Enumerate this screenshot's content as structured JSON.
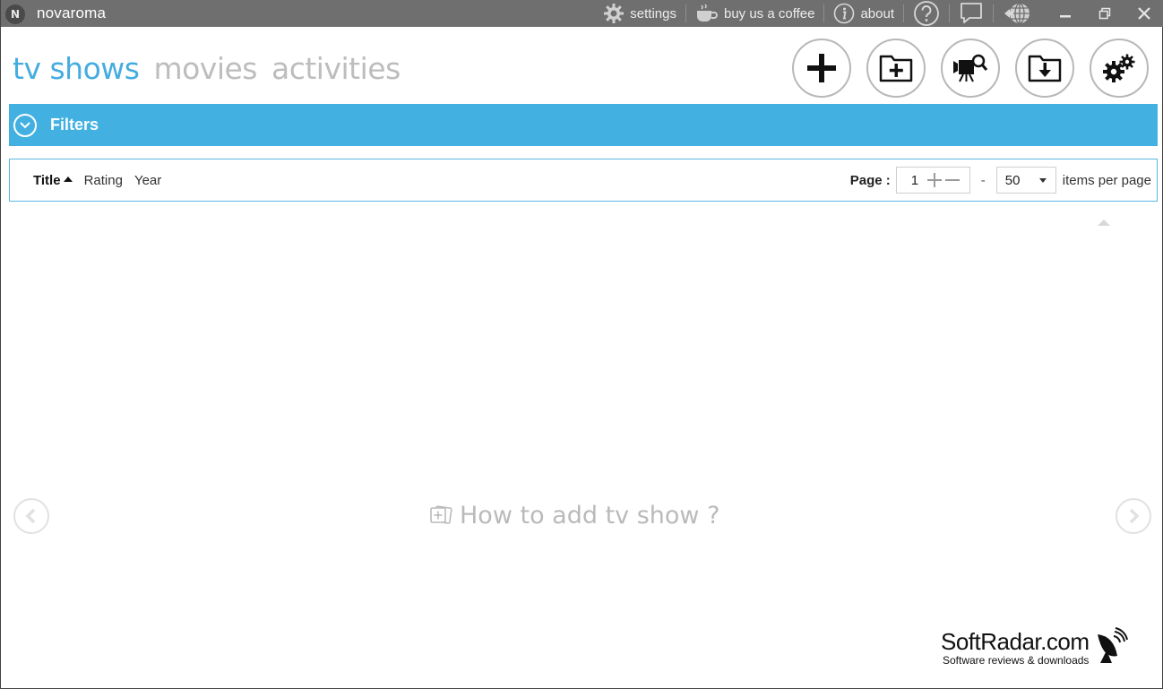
{
  "titlebar": {
    "logo_letter": "N",
    "app_name": "novaroma",
    "settings_label": "settings",
    "coffee_label": "buy us a coffee",
    "about_label": "about"
  },
  "nav": {
    "items": [
      {
        "label": "tv shows",
        "active": true
      },
      {
        "label": "movies",
        "active": false
      },
      {
        "label": "activities",
        "active": false
      }
    ]
  },
  "toolbar": {
    "icons": [
      "plus-icon",
      "add-folder-icon",
      "video-search-icon",
      "download-folder-icon",
      "gears-icon"
    ]
  },
  "filters": {
    "label": "Filters"
  },
  "sort": {
    "items": [
      {
        "label": "Title",
        "active": true
      },
      {
        "label": "Rating",
        "active": false
      },
      {
        "label": "Year",
        "active": false
      }
    ]
  },
  "paging": {
    "page_label": "Page :",
    "page_value": "1",
    "dash": "-",
    "per_page_value": "50",
    "items_label": "items per page"
  },
  "content": {
    "howto_label": "How to add tv show ?"
  },
  "watermark": {
    "name": "SoftRadar.com",
    "subtitle": "Software reviews & downloads"
  },
  "colors": {
    "accent": "#42b0e1",
    "titlebar": "#6f6f6f",
    "nav_inactive": "#bdbdbd"
  }
}
